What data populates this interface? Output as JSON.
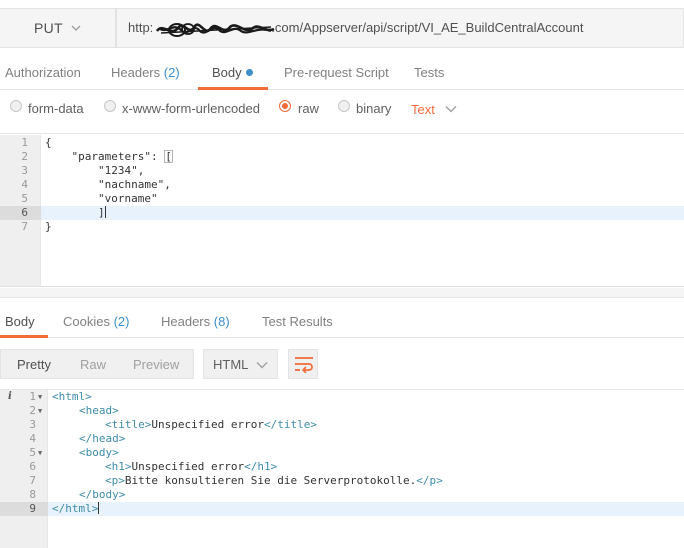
{
  "request": {
    "method": "PUT",
    "url_prefix": "http:",
    "url_suffix": ".com/Appserver/api/script/VI_AE_BuildCentralAccount"
  },
  "request_tabs": {
    "authorization": "Authorization",
    "headers": "Headers",
    "headers_count": "(2)",
    "body": "Body",
    "prerequest": "Pre-request Script",
    "tests": "Tests"
  },
  "body_types": {
    "form_data": "form-data",
    "urlencoded": "x-www-form-urlencoded",
    "raw": "raw",
    "binary": "binary",
    "content_type": "Text",
    "selected": "raw"
  },
  "request_body": {
    "line_numbers": [
      "1",
      "2",
      "3",
      "4",
      "5",
      "6",
      "7"
    ],
    "lines": [
      "{",
      "    \"parameters\": ",
      "        \"1234\",",
      "        \"nachname\",",
      "        \"vorname\"",
      "        ]",
      "}"
    ],
    "open_bracket": "[",
    "active_line": 6
  },
  "response_tabs": {
    "body": "Body",
    "cookies": "Cookies",
    "cookies_count": "(2)",
    "headers": "Headers",
    "headers_count": "(8)",
    "test_results": "Test Results"
  },
  "response_toolbar": {
    "pretty": "Pretty",
    "raw": "Raw",
    "preview": "Preview",
    "language": "HTML",
    "wrap_icon": "wrap-lines-icon"
  },
  "response_body": {
    "line_numbers": [
      "1",
      "2",
      "3",
      "4",
      "5",
      "6",
      "7",
      "8",
      "9"
    ],
    "info_glyph": "i",
    "l1_tag": "<html>",
    "l2_tag": "<head>",
    "l3_open": "<title>",
    "l3_text": "Unspecified error",
    "l3_close": "</title>",
    "l4_tag": "</head>",
    "l5_tag": "<body>",
    "l6_open": "<h1>",
    "l6_text": "Unspecified error",
    "l6_close": "</h1>",
    "l7_open": "<p>",
    "l7_text": "Bitte konsultieren Sie die Serverprotokolle.",
    "l7_close": "</p>",
    "l8_tag": "</body>",
    "l9_tag": "</html>",
    "active_line": 9
  },
  "colors": {
    "accent": "#f26b3a",
    "count_blue": "#3d8fc9",
    "tag_teal": "#3d8da8",
    "active_line_bg": "#e8f2fc"
  }
}
